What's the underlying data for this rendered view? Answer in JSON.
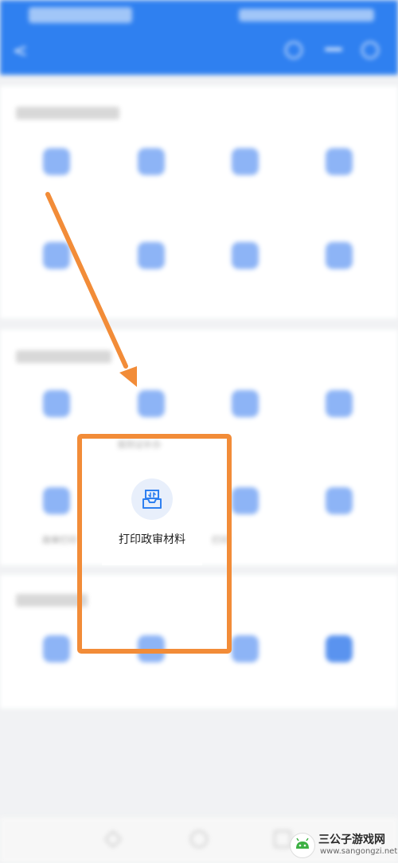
{
  "focus_item": {
    "label": "打印政审材料",
    "icon": "printer-tray-icon"
  },
  "partial_labels": {
    "upper": "报到证补办",
    "left": "政审打印",
    "right": "打印"
  },
  "annotation": {
    "arrow_color": "#f28c38",
    "box_color": "#f28c38"
  },
  "watermark": {
    "title": "三公子游戏网",
    "url": "www.sangongzi.net"
  },
  "colors": {
    "header": "#2f80f0",
    "icon_tint": "#8db4f6"
  }
}
